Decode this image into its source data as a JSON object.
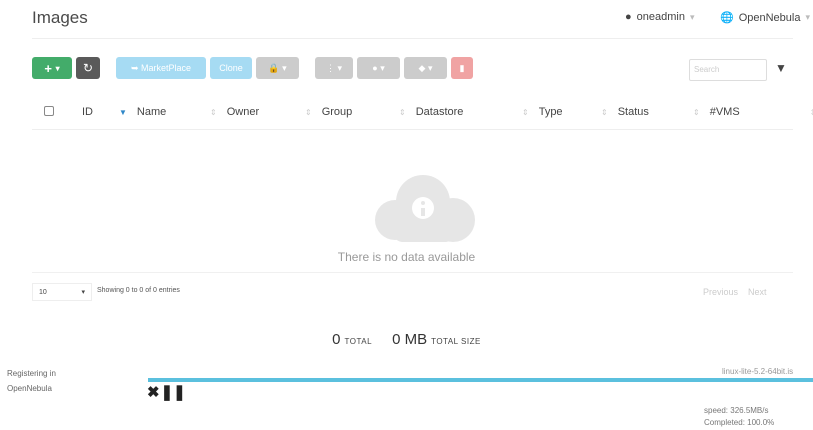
{
  "header": {
    "title": "Images",
    "user": "oneadmin",
    "zone": "OpenNebula"
  },
  "toolbar": {
    "add_label": "+",
    "marketplace_label": "MarketPlace",
    "clone_label": "Clone",
    "search_placeholder": "Search"
  },
  "table": {
    "columns": [
      "ID",
      "Name",
      "Owner",
      "Group",
      "Datastore",
      "Type",
      "Status",
      "#VMS"
    ],
    "rows": [],
    "empty_text": "There is no data available"
  },
  "pagination": {
    "page_size": "10",
    "showing": "Showing 0 to 0 of 0 entries",
    "previous": "Previous",
    "next": "Next"
  },
  "totals": {
    "total_count": "0",
    "total_label": "TOTAL",
    "size_value": "0 MB",
    "size_label": "TOTAL SIZE"
  },
  "upload": {
    "label_line1": "Registering in",
    "label_line2": "OpenNebula",
    "file": "linux-lite-5.2-64bit.is",
    "speed": "speed: 326.5MB/s",
    "completed": "Completed: 100.0%",
    "progress_percent": 100
  },
  "colors": {
    "green": "#43ac6a",
    "progress": "#5bc0de",
    "sort_active": "#2f87c8"
  }
}
